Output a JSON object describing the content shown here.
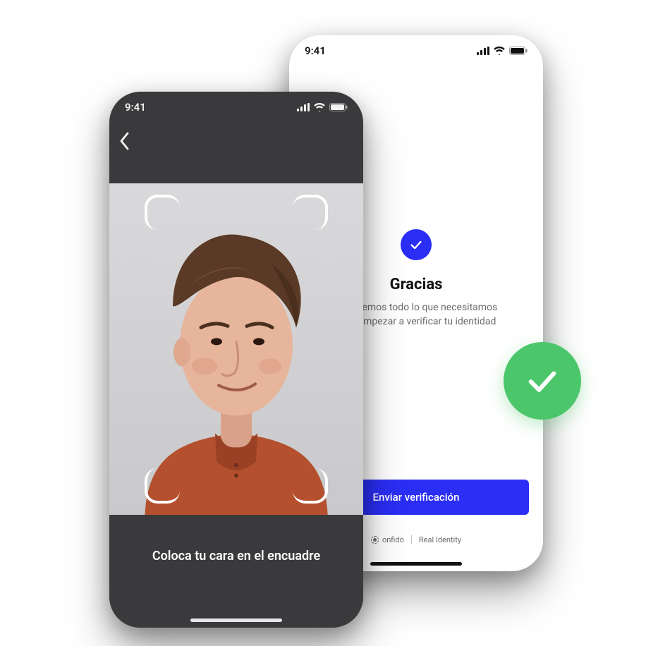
{
  "status": {
    "time": "9:41"
  },
  "front": {
    "instruction": "Coloca tu cara en el encuadre"
  },
  "back": {
    "title": "Gracias",
    "subtitle": "Ya tenemos todo lo que necesitamos\npara empezar a verificar tu identidad",
    "cta": "Enviar verificación",
    "brand_name": "onfido",
    "brand_tagline": "Real Identity"
  }
}
